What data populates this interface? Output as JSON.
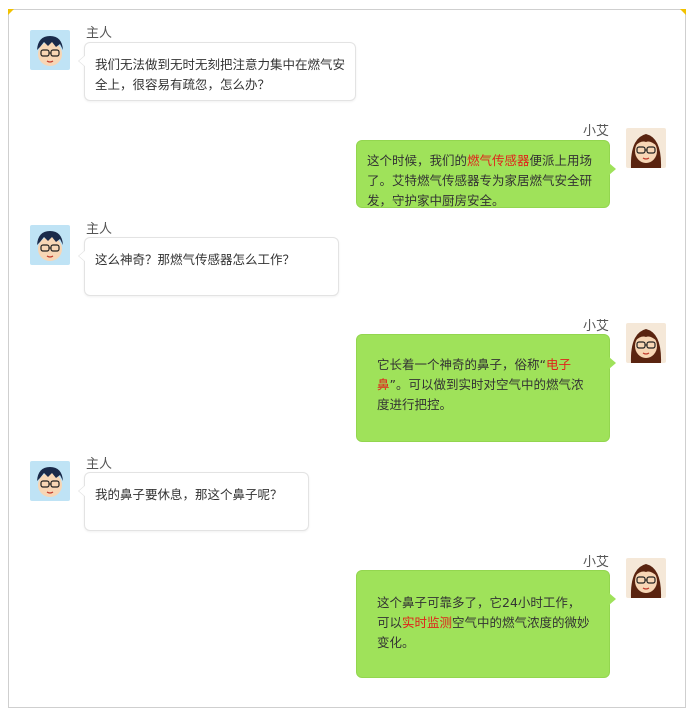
{
  "colors": {
    "accent_corner": "#f2c200",
    "bot_bubble": "#9fe25a",
    "highlight": "#e0231b"
  },
  "messages": [
    {
      "speaker": "主人",
      "side": "left",
      "avatar": "boy-avatar-icon",
      "parts": [
        "我们无法做到无时无刻把注意力集中在燃气安全上，很容易有疏忽，怎么办？"
      ]
    },
    {
      "speaker": "小艾",
      "side": "right",
      "avatar": "girl-avatar-icon",
      "parts": [
        "这个时候，我们的",
        "燃气传感器",
        "便派上用场了。艾特燃气传感器专为家居燃气安全研发，守护家中厨房安全。"
      ]
    },
    {
      "speaker": "主人",
      "side": "left",
      "avatar": "boy-avatar-icon",
      "parts": [
        "这么神奇？那燃气传感器怎么工作？"
      ]
    },
    {
      "speaker": "小艾",
      "side": "right",
      "avatar": "girl-avatar-icon",
      "parts": [
        "它长着一个神奇的鼻子，俗称“",
        "电子鼻",
        "”。可以做到实时对空气中的燃气浓度进行把控。"
      ]
    },
    {
      "speaker": "主人",
      "side": "left",
      "avatar": "boy-avatar-icon",
      "parts": [
        "我的鼻子要休息，那这个鼻子呢？"
      ]
    },
    {
      "speaker": "小艾",
      "side": "right",
      "avatar": "girl-avatar-icon",
      "parts": [
        "这个鼻子可靠多了，它24小时工作，可以",
        "实时监测",
        "空气中的燃气浓度的微妙变化。"
      ]
    }
  ]
}
